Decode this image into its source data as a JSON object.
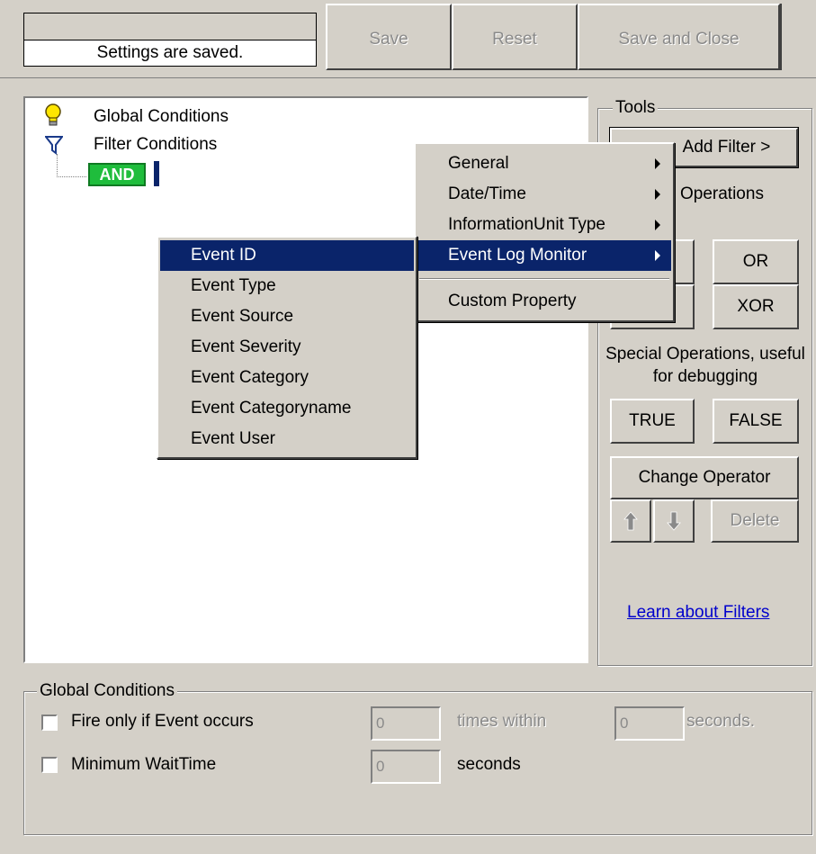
{
  "toolbar": {
    "status": "Settings are saved.",
    "save_label": "Save",
    "reset_label": "Reset",
    "save_close_label": "Save and Close"
  },
  "tree": {
    "global_conditions": "Global Conditions",
    "filter_conditions": "Filter Conditions",
    "and_node": "AND"
  },
  "tools": {
    "group_label": "Tools",
    "add_filter_label": "Add Filter >",
    "operations_label": "Operations",
    "or_label": "OR",
    "xor_label": "XOR",
    "special_ops_label": "Special Operations, useful for debugging",
    "true_label": "TRUE",
    "false_label": "FALSE",
    "change_operator_label": "Change Operator",
    "delete_label": "Delete",
    "learn_link": "Learn about Filters"
  },
  "menu_main": {
    "items": [
      "General",
      "Date/Time",
      "InformationUnit Type",
      "Event Log Monitor",
      "Custom Property"
    ],
    "selected": "Event Log Monitor"
  },
  "menu_sub": {
    "items": [
      "Event ID",
      "Event Type",
      "Event Source",
      "Event Severity",
      "Event Category",
      "Event Categoryname",
      "Event User"
    ],
    "selected": "Event ID"
  },
  "global": {
    "group_label": "Global Conditions",
    "fire_label": "Fire only if Event occurs",
    "fire_times_value": "0",
    "times_within_label": "times within",
    "fire_seconds_value": "0",
    "seconds_label_1": "seconds.",
    "min_wait_label": "Minimum WaitTime",
    "min_wait_value": "0",
    "seconds_label_2": "seconds"
  },
  "colors": {
    "face": "#d4d0c8",
    "highlight": "#0a246a",
    "and_node": "#1fbd3c",
    "link": "#0000cc"
  }
}
